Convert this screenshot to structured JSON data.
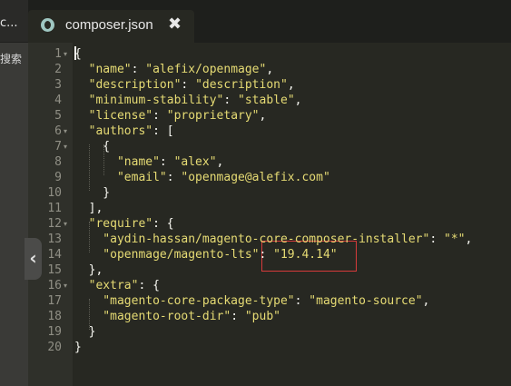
{
  "sidebar": {
    "fragment_top": "c...",
    "fragment_search": "搜索"
  },
  "tab": {
    "title": "composer.json",
    "close_glyph": "✖"
  },
  "lines": [
    {
      "num": "1",
      "fold": true,
      "tokens": [
        {
          "t": "{",
          "c": "p"
        }
      ]
    },
    {
      "num": "2",
      "tokens": [
        {
          "t": "  \"name\"",
          "c": "k"
        },
        {
          "t": ": ",
          "c": "p"
        },
        {
          "t": "\"alefix/openmage\"",
          "c": "k"
        },
        {
          "t": ",",
          "c": "p"
        }
      ]
    },
    {
      "num": "3",
      "tokens": [
        {
          "t": "  \"description\"",
          "c": "k"
        },
        {
          "t": ": ",
          "c": "p"
        },
        {
          "t": "\"description\"",
          "c": "k"
        },
        {
          "t": ",",
          "c": "p"
        }
      ]
    },
    {
      "num": "4",
      "tokens": [
        {
          "t": "  \"minimum-stability\"",
          "c": "k"
        },
        {
          "t": ": ",
          "c": "p"
        },
        {
          "t": "\"stable\"",
          "c": "k"
        },
        {
          "t": ",",
          "c": "p"
        }
      ]
    },
    {
      "num": "5",
      "tokens": [
        {
          "t": "  \"license\"",
          "c": "k"
        },
        {
          "t": ": ",
          "c": "p"
        },
        {
          "t": "\"proprietary\"",
          "c": "k"
        },
        {
          "t": ",",
          "c": "p"
        }
      ]
    },
    {
      "num": "6",
      "fold": true,
      "tokens": [
        {
          "t": "  \"authors\"",
          "c": "k"
        },
        {
          "t": ": [",
          "c": "p"
        }
      ]
    },
    {
      "num": "7",
      "fold": true,
      "tokens": [
        {
          "t": "    {",
          "c": "p"
        }
      ]
    },
    {
      "num": "8",
      "tokens": [
        {
          "t": "      \"name\"",
          "c": "k"
        },
        {
          "t": ": ",
          "c": "p"
        },
        {
          "t": "\"alex\"",
          "c": "k"
        },
        {
          "t": ",",
          "c": "p"
        }
      ]
    },
    {
      "num": "9",
      "tokens": [
        {
          "t": "      \"email\"",
          "c": "k"
        },
        {
          "t": ": ",
          "c": "p"
        },
        {
          "t": "\"openmage@alefix.com\"",
          "c": "k"
        }
      ]
    },
    {
      "num": "10",
      "tokens": [
        {
          "t": "    }",
          "c": "p"
        }
      ]
    },
    {
      "num": "11",
      "tokens": [
        {
          "t": "  ],",
          "c": "p"
        }
      ]
    },
    {
      "num": "12",
      "fold": true,
      "tokens": [
        {
          "t": "  \"require\"",
          "c": "k"
        },
        {
          "t": ": {",
          "c": "p"
        }
      ]
    },
    {
      "num": "13",
      "tokens": [
        {
          "t": "    \"aydin-hassan/magento-core-composer-installer\"",
          "c": "k"
        },
        {
          "t": ": ",
          "c": "p"
        },
        {
          "t": "\"*\"",
          "c": "k"
        },
        {
          "t": ",",
          "c": "p"
        }
      ]
    },
    {
      "num": "14",
      "tokens": [
        {
          "t": "    \"openmage/magento-lts\"",
          "c": "k"
        },
        {
          "t": ": ",
          "c": "p"
        },
        {
          "t": "\"19.4.14\"",
          "c": "k"
        }
      ]
    },
    {
      "num": "15",
      "tokens": [
        {
          "t": "  },",
          "c": "p"
        }
      ]
    },
    {
      "num": "16",
      "fold": true,
      "tokens": [
        {
          "t": "  \"extra\"",
          "c": "k"
        },
        {
          "t": ": {",
          "c": "p"
        }
      ]
    },
    {
      "num": "17",
      "tokens": [
        {
          "t": "    \"magento-core-package-type\"",
          "c": "k"
        },
        {
          "t": ": ",
          "c": "p"
        },
        {
          "t": "\"magento-source\"",
          "c": "k"
        },
        {
          "t": ",",
          "c": "p"
        }
      ]
    },
    {
      "num": "18",
      "tokens": [
        {
          "t": "    \"magento-root-dir\"",
          "c": "k"
        },
        {
          "t": ": ",
          "c": "p"
        },
        {
          "t": "\"pub\"",
          "c": "k"
        }
      ]
    },
    {
      "num": "19",
      "tokens": [
        {
          "t": "  }",
          "c": "p"
        }
      ]
    },
    {
      "num": "20",
      "tokens": [
        {
          "t": "}",
          "c": "p"
        }
      ]
    }
  ],
  "theme": {
    "background": "#272822",
    "gutter": "#2f302a",
    "string_color": "#e6db74",
    "punctuation_color": "#f8f8f2",
    "line_number_color": "#908f85",
    "annotation_color": "#d63b3b"
  }
}
